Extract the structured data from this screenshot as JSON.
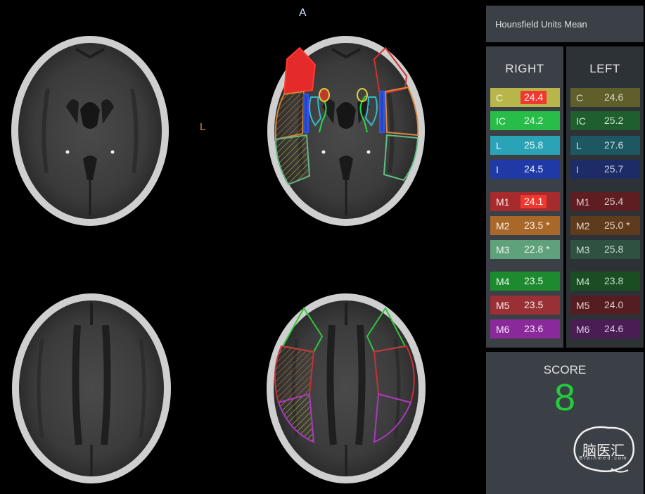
{
  "viewer": {
    "orientation_top": "A",
    "orientation_side": "L"
  },
  "panel": {
    "title": "Hounsfield Units Mean",
    "right_header": "RIGHT",
    "left_header": "LEFT",
    "right_rows": [
      {
        "region": "C",
        "value": "24.4",
        "bg": "#b8b64a",
        "color": "#f4f4e6",
        "highlight": true
      },
      {
        "region": "IC",
        "value": "24.2",
        "bg": "#28bd48",
        "color": "#eaf9ee",
        "highlight": false
      },
      {
        "region": "L",
        "value": "25.8",
        "bg": "#2ba3b6",
        "color": "#e8f6f9",
        "highlight": false
      },
      {
        "region": "I",
        "value": "24.5",
        "bg": "#1f3aa6",
        "color": "#e6ebfa",
        "highlight": false
      },
      {
        "region": "M1",
        "value": "24.1",
        "bg": "#a72b2d",
        "color": "#fbe9e9",
        "highlight": true
      },
      {
        "region": "M2",
        "value": "23.5 *",
        "bg": "#a9672a",
        "color": "#fbf0e6",
        "highlight": false
      },
      {
        "region": "M3",
        "value": "22.8 *",
        "bg": "#5fa17b",
        "color": "#eaf5ee",
        "highlight": false
      },
      {
        "region": "M4",
        "value": "23.5",
        "bg": "#1e8a2f",
        "color": "#e8f6ea",
        "highlight": false
      },
      {
        "region": "M5",
        "value": "23.5",
        "bg": "#983036",
        "color": "#f9e8e9",
        "highlight": false
      },
      {
        "region": "M6",
        "value": "23.6",
        "bg": "#8a2a9a",
        "color": "#f6e8f9",
        "highlight": false
      }
    ],
    "left_rows": [
      {
        "region": "C",
        "value": "24.6",
        "bg": "#5f5f2c",
        "color": "#d9d9c4"
      },
      {
        "region": "IC",
        "value": "25.2",
        "bg": "#1f5f2d",
        "color": "#c9e3cf"
      },
      {
        "region": "L",
        "value": "27.6",
        "bg": "#1d5862",
        "color": "#c7e0e5"
      },
      {
        "region": "I",
        "value": "25.7",
        "bg": "#1d2b66",
        "color": "#c9cfe6"
      },
      {
        "region": "M1",
        "value": "25.4",
        "bg": "#5e1d20",
        "color": "#e3c9ca"
      },
      {
        "region": "M2",
        "value": "25.0 *",
        "bg": "#5e3b1c",
        "color": "#e4d5c6"
      },
      {
        "region": "M3",
        "value": "25.8",
        "bg": "#2e5142",
        "color": "#cbded5"
      },
      {
        "region": "M4",
        "value": "23.8",
        "bg": "#1a4d22",
        "color": "#c8dfcc"
      },
      {
        "region": "M5",
        "value": "24.0",
        "bg": "#541d22",
        "color": "#e1c9cb"
      },
      {
        "region": "M6",
        "value": "24.6",
        "bg": "#4a1d55",
        "color": "#dccae2"
      }
    ],
    "score_label": "SCORE",
    "score_value": "8",
    "brand": {
      "name": "脑医汇",
      "subtitle": "Brainmed.com"
    }
  }
}
